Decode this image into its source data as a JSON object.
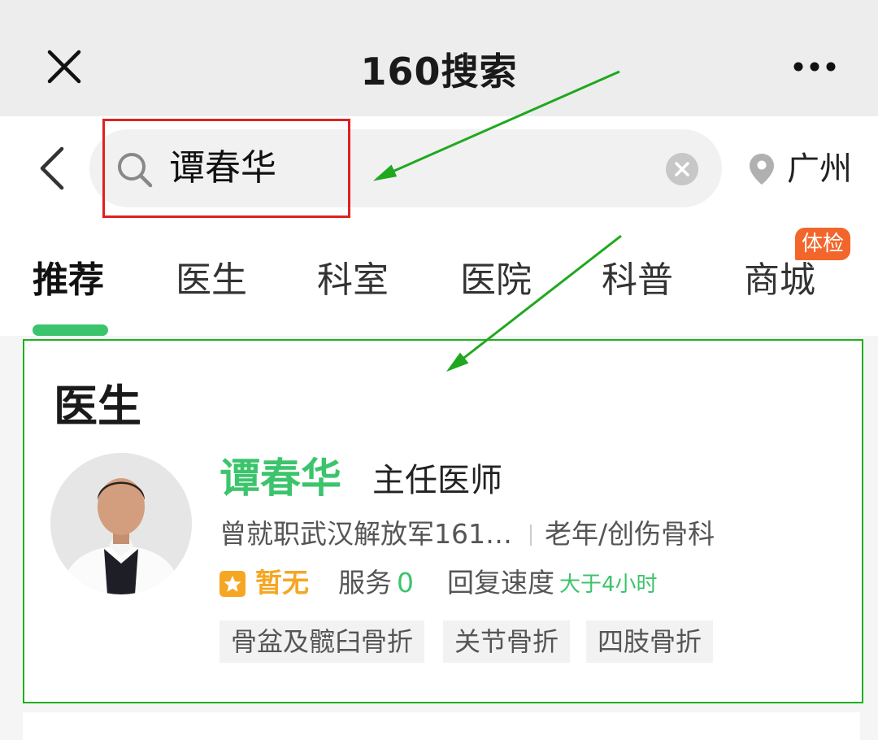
{
  "top_bar": {
    "title": "160搜索"
  },
  "search": {
    "query": "谭春华",
    "location": "广州"
  },
  "tabs": [
    {
      "label": "推荐",
      "active": true
    },
    {
      "label": "医生"
    },
    {
      "label": "科室"
    },
    {
      "label": "医院"
    },
    {
      "label": "科普"
    },
    {
      "label": "商城",
      "badge": "体检"
    }
  ],
  "section": {
    "heading": "医生",
    "doctor": {
      "name": "谭春华",
      "title": "主任医师",
      "hospital": "曾就职武汉解放军161…",
      "department": "老年/创伤骨科",
      "rating": "暂无",
      "service_label": "服务",
      "service_count": "0",
      "reply_label": "回复速度",
      "reply_value": "大于4小时",
      "tags": [
        "骨盆及髋臼骨折",
        "关节骨折",
        "四肢骨折"
      ]
    }
  },
  "colors": {
    "accent_green": "#3cc46c",
    "annotation_red": "#e02020",
    "annotation_green": "#1fb01f",
    "badge_orange": "#f2662b",
    "rating_gold": "#f5a623"
  }
}
